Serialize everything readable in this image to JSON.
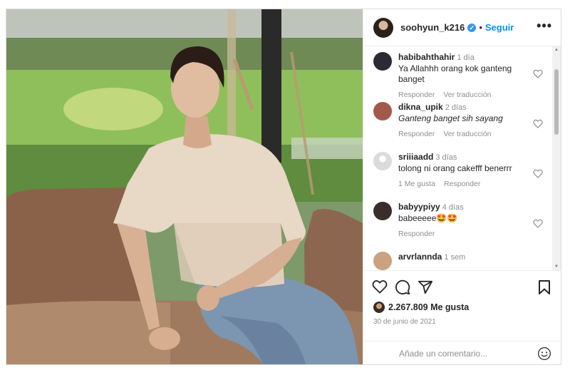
{
  "post": {
    "username": "soohyun_k216",
    "verified_mark": "✓",
    "separator": "•",
    "follow_label": "Seguir",
    "more_label": "•••",
    "likes_text": "2.267.809 Me gusta",
    "date": "30 de junio de 2021",
    "comment_placeholder": "Añade un comentario..."
  },
  "comments": [
    {
      "user": "habibahthahir",
      "time": "1 día",
      "text": "Ya Allahhh orang kok ganteng banget",
      "italic": false,
      "actions": [
        "Responder",
        "Ver traducción"
      ],
      "avatar_color": "#2e2a33"
    },
    {
      "user": "dikna_upik",
      "time": "2 días",
      "text": "Ganteng banget sih sayang",
      "italic": true,
      "actions": [
        "Responder",
        "Ver traducción"
      ],
      "avatar_color": "#a15a4a"
    },
    {
      "user": "sriiiaadd",
      "time": "3 días",
      "text": "tolong ni orang cakefff benerrr",
      "italic": false,
      "actions": [
        "1 Me gusta",
        "Responder"
      ],
      "avatar_color": "#dbdbdb"
    },
    {
      "user": "babyypiyy",
      "time": "4 días",
      "text": "babeeeee🤩🤩",
      "italic": false,
      "actions": [
        "Responder"
      ],
      "avatar_color": "#3a2e2a"
    },
    {
      "user": "arvrlannda",
      "time": "1 sem",
      "text": "",
      "italic": false,
      "actions": [],
      "avatar_color": "#c9a27e"
    }
  ],
  "icons": {
    "like": "heart-icon",
    "comment": "comment-icon",
    "share": "share-icon",
    "save": "bookmark-icon",
    "emoji": "emoji-icon",
    "more": "more-icon"
  },
  "colors": {
    "accent": "#0095f6",
    "verified": "#3897f0",
    "muted": "#8e8e8e"
  }
}
